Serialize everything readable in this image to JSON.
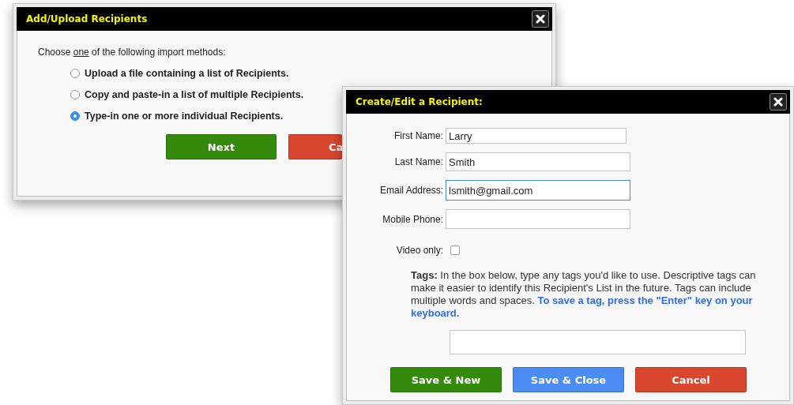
{
  "import_dialog": {
    "title": "Add/Upload Recipients",
    "prompt": {
      "before": "Choose ",
      "underlined": "one",
      "after": " of the following import methods:"
    },
    "options": [
      {
        "label": "Upload a file containing a list of Recipients.",
        "selected": false
      },
      {
        "label": "Copy and paste-in a list of multiple Recipients.",
        "selected": false
      },
      {
        "label": "Type-in one or more individual Recipients.",
        "selected": true
      }
    ],
    "buttons": [
      {
        "label": "Next",
        "kind": "success"
      },
      {
        "label": "Ca",
        "kind": "danger"
      }
    ]
  },
  "recipient_dialog": {
    "title": "Create/Edit a Recipient:",
    "fields": [
      {
        "label": "First Name:",
        "value": "Larry",
        "focused": false
      },
      {
        "label": "Last Name:",
        "value": "Smith",
        "focused": false
      },
      {
        "label": "Email Address:",
        "value": "lsmith@gmail.com",
        "focused": true
      },
      {
        "label": "Mobile Phone:",
        "focused": false
      }
    ],
    "video_only": {
      "label": "Video only:",
      "checked": false
    },
    "tags_help": {
      "label": "Tags:",
      "text": "In the box below, type any tags you'd like to use. Descriptive tags can make it easier to identify this Recipient's List in the future. Tags can include multiple words and spaces.",
      "highlight": "To save a tag, press the \"Enter\" key on your keyboard."
    },
    "buttons": [
      {
        "label": "Save & New",
        "kind": "success"
      },
      {
        "label": "Save & Close",
        "kind": "primary"
      },
      {
        "label": "Cancel",
        "kind": "danger"
      }
    ]
  }
}
